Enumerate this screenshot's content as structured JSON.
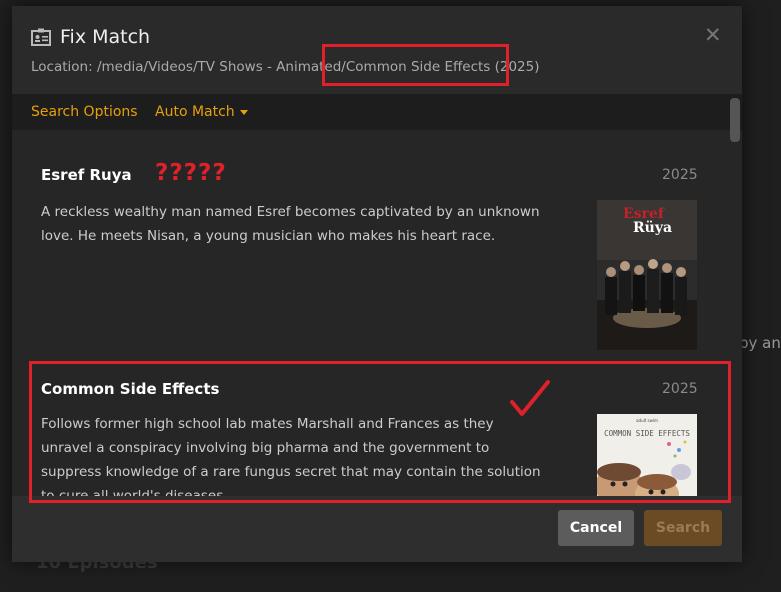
{
  "background": {
    "right_text": "by an",
    "episodes": "10 Episodes"
  },
  "dialog": {
    "title": "Fix Match",
    "location": "Location: /media/Videos/TV Shows - Animated/Common Side Effects (2025)",
    "close_icon": "close-icon",
    "title_icon": "id-card-icon",
    "tabs": [
      {
        "label": "Search Options"
      },
      {
        "label": "Auto Match"
      }
    ],
    "results": [
      {
        "title": "Esref Ruya",
        "year": "2025",
        "description": "A reckless wealthy man named Esref becomes captivated by an unknown love. He meets Nisan, a young musician who makes his heart race.",
        "poster": {
          "line1": "Esref",
          "line2": "Rüya"
        }
      },
      {
        "title": "Common Side Effects",
        "year": "2025",
        "description": "Follows former high school lab mates Marshall and Frances as they unravel a conspiracy involving big pharma and the government to suppress knowledge of a rare fungus secret that may contain the solution to cure all world's diseases.",
        "poster": {
          "small": "adult swim",
          "title": "COMMON SIDE EFFECTS"
        }
      }
    ],
    "buttons": {
      "cancel": "Cancel",
      "search": "Search"
    }
  },
  "annotations": {
    "question_marks": "?????"
  },
  "colors": {
    "accent": "#e5a00d",
    "annotation_red": "#e0202a"
  }
}
